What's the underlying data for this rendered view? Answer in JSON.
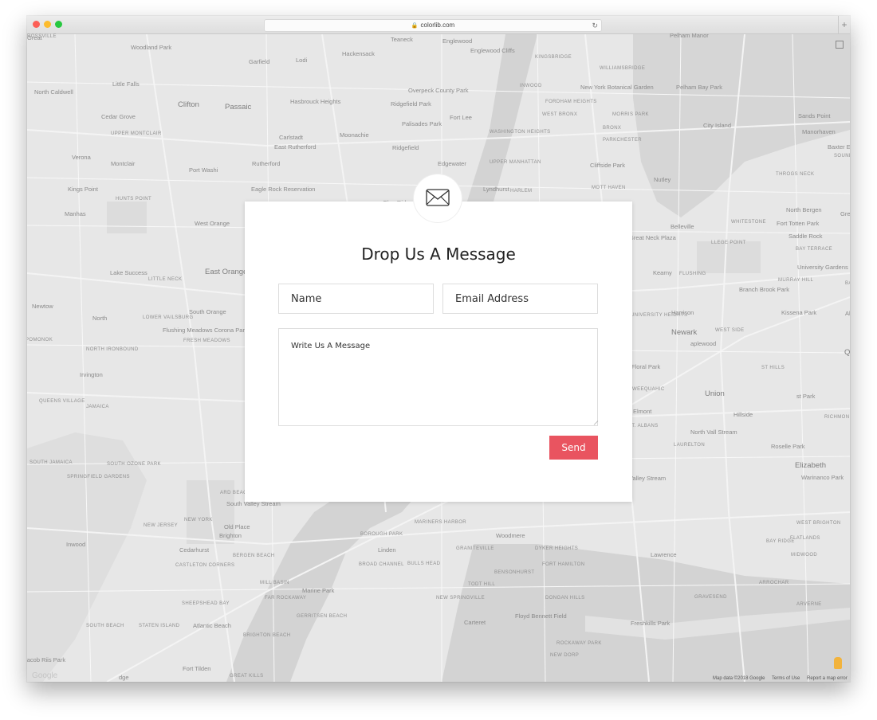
{
  "browser": {
    "url": "colorlib.com"
  },
  "map": {
    "labels": [
      {
        "text": "Woodland Park",
        "cls": ""
      },
      {
        "text": "Garfield",
        "cls": ""
      },
      {
        "text": "Lodi",
        "cls": ""
      },
      {
        "text": "Hackensack",
        "cls": ""
      },
      {
        "text": "Teaneck",
        "cls": ""
      },
      {
        "text": "Englewood",
        "cls": ""
      },
      {
        "text": "Englewood Cliffs",
        "cls": ""
      },
      {
        "text": "KINGSBRIDGE",
        "cls": "caps"
      },
      {
        "text": "WILLIAMSBRIDGE",
        "cls": "caps"
      },
      {
        "text": "Pelham Manor",
        "cls": ""
      },
      {
        "text": "Little Falls",
        "cls": ""
      },
      {
        "text": "North Caldwell",
        "cls": ""
      },
      {
        "text": "Clifton",
        "cls": "big"
      },
      {
        "text": "Passaic",
        "cls": "big"
      },
      {
        "text": "Hasbrouck Heights",
        "cls": ""
      },
      {
        "text": "Overpeck County Park",
        "cls": ""
      },
      {
        "text": "Ridgefield Park",
        "cls": ""
      },
      {
        "text": "INWOOD",
        "cls": "caps"
      },
      {
        "text": "New York Botanical Garden",
        "cls": ""
      },
      {
        "text": "Pelham Bay Park",
        "cls": ""
      },
      {
        "text": "Cedar Grove",
        "cls": ""
      },
      {
        "text": "UPPER MONTCLAIR",
        "cls": "caps"
      },
      {
        "text": "Palisades Park",
        "cls": ""
      },
      {
        "text": "Fort Lee",
        "cls": ""
      },
      {
        "text": "FORDHAM HEIGHTS",
        "cls": "caps"
      },
      {
        "text": "WEST BRONX",
        "cls": "caps"
      },
      {
        "text": "MORRIS PARK",
        "cls": "caps"
      },
      {
        "text": "City Island",
        "cls": ""
      },
      {
        "text": "Sands Point",
        "cls": ""
      },
      {
        "text": "Carlstadt",
        "cls": ""
      },
      {
        "text": "Moonachie",
        "cls": ""
      },
      {
        "text": "WASHINGTON HEIGHTS",
        "cls": "caps"
      },
      {
        "text": "BRONX",
        "cls": "caps"
      },
      {
        "text": "Manorhaven",
        "cls": ""
      },
      {
        "text": "East Rutherford",
        "cls": ""
      },
      {
        "text": "Ridgefield",
        "cls": ""
      },
      {
        "text": "PARKCHESTER",
        "cls": "caps"
      },
      {
        "text": "Baxter E",
        "cls": ""
      },
      {
        "text": "Verona",
        "cls": ""
      },
      {
        "text": "Montclair",
        "cls": ""
      },
      {
        "text": "Rutherford",
        "cls": ""
      },
      {
        "text": "Edgewater",
        "cls": ""
      },
      {
        "text": "UPPER MANHATTAN",
        "cls": "caps"
      },
      {
        "text": "Cliffside Park",
        "cls": ""
      },
      {
        "text": "SOUNDVIEW",
        "cls": "caps"
      },
      {
        "text": "Port Washi",
        "cls": ""
      },
      {
        "text": "Nutley",
        "cls": ""
      },
      {
        "text": "THROGS NECK",
        "cls": "caps"
      },
      {
        "text": "Kings Point",
        "cls": ""
      },
      {
        "text": "Eagle Rock Reservation",
        "cls": ""
      },
      {
        "text": "Lyndhurst",
        "cls": ""
      },
      {
        "text": "HARLEM",
        "cls": "caps"
      },
      {
        "text": "MOTT HAVEN",
        "cls": "caps"
      },
      {
        "text": "HUNTS POINT",
        "cls": "caps"
      },
      {
        "text": "Glen Ridge",
        "cls": ""
      },
      {
        "text": "North Bergen",
        "cls": ""
      },
      {
        "text": "Great Neck",
        "cls": ""
      },
      {
        "text": "Manhas",
        "cls": ""
      },
      {
        "text": "West Orange",
        "cls": ""
      },
      {
        "text": "Belleville",
        "cls": ""
      },
      {
        "text": "WHITESTONE",
        "cls": "caps"
      },
      {
        "text": "Fort Totten Park",
        "cls": ""
      },
      {
        "text": "Saddle Rock",
        "cls": ""
      },
      {
        "text": "Great Neck Plaza",
        "cls": ""
      },
      {
        "text": "LLEGE POINT",
        "cls": "caps"
      },
      {
        "text": "BAY TERRACE",
        "cls": "caps"
      },
      {
        "text": "University Gardens",
        "cls": ""
      },
      {
        "text": "Lake Success",
        "cls": ""
      },
      {
        "text": "East Orange",
        "cls": "big"
      },
      {
        "text": "Kearny",
        "cls": ""
      },
      {
        "text": "FLUSHING",
        "cls": "caps"
      },
      {
        "text": "MURRAY HILL",
        "cls": "caps"
      },
      {
        "text": "LITTLE NECK",
        "cls": "caps"
      },
      {
        "text": "Branch Brook Park",
        "cls": ""
      },
      {
        "text": "BAYSIDE",
        "cls": "caps"
      },
      {
        "text": "Newtow",
        "cls": ""
      },
      {
        "text": "South Orange",
        "cls": ""
      },
      {
        "text": "Harrison",
        "cls": ""
      },
      {
        "text": "Kissena Park",
        "cls": ""
      },
      {
        "text": "Alley Pond Park",
        "cls": ""
      },
      {
        "text": "North",
        "cls": ""
      },
      {
        "text": "LOWER VAILSBURG",
        "cls": "caps"
      },
      {
        "text": "UNIVERSITY HEIGHTS",
        "cls": "caps"
      },
      {
        "text": "Flushing Meadows Corona Park",
        "cls": ""
      },
      {
        "text": "Newark",
        "cls": "big"
      },
      {
        "text": "WEST SIDE",
        "cls": "caps"
      },
      {
        "text": "POMONOK",
        "cls": "caps"
      },
      {
        "text": "FRESH MEADOWS",
        "cls": "caps"
      },
      {
        "text": "aplewood",
        "cls": ""
      },
      {
        "text": "NORTH IRONBOUND",
        "cls": "caps"
      },
      {
        "text": "QUEENS",
        "cls": "big"
      },
      {
        "text": "Irvington",
        "cls": ""
      },
      {
        "text": "Floral Park",
        "cls": ""
      },
      {
        "text": "ST HILLS",
        "cls": "caps"
      },
      {
        "text": "QUEENS VILLAGE",
        "cls": "caps"
      },
      {
        "text": "WEEQUAHIC",
        "cls": "caps"
      },
      {
        "text": "Union",
        "cls": "big"
      },
      {
        "text": "st Park",
        "cls": ""
      },
      {
        "text": "JAMAICA",
        "cls": "caps"
      },
      {
        "text": "Elmont",
        "cls": ""
      },
      {
        "text": "Hillside",
        "cls": ""
      },
      {
        "text": "RICHMOND HILL",
        "cls": "caps"
      },
      {
        "text": "ST. ALBANS",
        "cls": "caps"
      },
      {
        "text": "North Vall Stream",
        "cls": ""
      },
      {
        "text": "SOUTH JAMAICA",
        "cls": "caps"
      },
      {
        "text": "SOUTH OZONE PARK",
        "cls": "caps"
      },
      {
        "text": "LAURELTON",
        "cls": "caps"
      },
      {
        "text": "Roselle Park",
        "cls": ""
      },
      {
        "text": "Elizabeth",
        "cls": "big"
      },
      {
        "text": "SPRINGFIELD GARDENS",
        "cls": "caps"
      },
      {
        "text": "Valley Stream",
        "cls": ""
      },
      {
        "text": "Warinanco Park",
        "cls": ""
      },
      {
        "text": "ARD BEACH",
        "cls": "caps"
      },
      {
        "text": "South Valley Stream",
        "cls": ""
      },
      {
        "text": "NEW JERSEY",
        "cls": "caps"
      },
      {
        "text": "NEW YORK",
        "cls": "caps"
      },
      {
        "text": "Old Place",
        "cls": ""
      },
      {
        "text": "MARINERS HARBOR",
        "cls": "caps"
      },
      {
        "text": "Brighton",
        "cls": ""
      },
      {
        "text": "BOROUGH PARK",
        "cls": "caps"
      },
      {
        "text": "Woodmere",
        "cls": ""
      },
      {
        "text": "WEST BRIGHTON",
        "cls": "caps"
      },
      {
        "text": "BAY RIDGE",
        "cls": "caps"
      },
      {
        "text": "FLATLANDS",
        "cls": "caps"
      },
      {
        "text": "Inwood",
        "cls": ""
      },
      {
        "text": "Cedarhurst",
        "cls": ""
      },
      {
        "text": "Linden",
        "cls": ""
      },
      {
        "text": "GRANITEVILLE",
        "cls": "caps"
      },
      {
        "text": "DYKER HEIGHTS",
        "cls": "caps"
      },
      {
        "text": "MIDWOOD",
        "cls": "caps"
      },
      {
        "text": "BERGEN BEACH",
        "cls": "caps"
      },
      {
        "text": "Lawrence",
        "cls": ""
      },
      {
        "text": "CASTLETON CORNERS",
        "cls": "caps"
      },
      {
        "text": "BROAD CHANNEL",
        "cls": "caps"
      },
      {
        "text": "BULLS HEAD",
        "cls": "caps"
      },
      {
        "text": "FORT HAMILTON",
        "cls": "caps"
      },
      {
        "text": "BENSONHURST",
        "cls": "caps"
      },
      {
        "text": "MILL BASIN",
        "cls": "caps"
      },
      {
        "text": "Marine Park",
        "cls": ""
      },
      {
        "text": "TODT HILL",
        "cls": "caps"
      },
      {
        "text": "ARROCHAR",
        "cls": "caps"
      },
      {
        "text": "SHEEPSHEAD BAY",
        "cls": "caps"
      },
      {
        "text": "FAR ROCKAWAY",
        "cls": "caps"
      },
      {
        "text": "NEW SPRINGVILLE",
        "cls": "caps"
      },
      {
        "text": "DONGAN HILLS",
        "cls": "caps"
      },
      {
        "text": "GRAVESEND",
        "cls": "caps"
      },
      {
        "text": "Floyd Bennett Field",
        "cls": ""
      },
      {
        "text": "ARVERNE",
        "cls": "caps"
      },
      {
        "text": "GERRITSEN BEACH",
        "cls": "caps"
      },
      {
        "text": "Atlantic Beach",
        "cls": ""
      },
      {
        "text": "SOUTH BEACH",
        "cls": "caps"
      },
      {
        "text": "STATEN ISLAND",
        "cls": "caps"
      },
      {
        "text": "Carteret",
        "cls": ""
      },
      {
        "text": "Freshkills Park",
        "cls": ""
      },
      {
        "text": "BRIGHTON BEACH",
        "cls": "caps"
      },
      {
        "text": "ROCKAWAY PARK",
        "cls": "caps"
      },
      {
        "text": "NEW DORP",
        "cls": "caps"
      },
      {
        "text": "Jacob Riis Park",
        "cls": ""
      },
      {
        "text": "Fort Tilden",
        "cls": ""
      },
      {
        "text": "dge",
        "cls": ""
      },
      {
        "text": "GREAT KILLS",
        "cls": "caps"
      },
      {
        "text": "ROSSVILLE",
        "cls": "caps"
      },
      {
        "text": "Great",
        "cls": ""
      }
    ],
    "footer": {
      "map_data": "Map data ©2018 Google",
      "terms": "Terms of Use",
      "report": "Report a map error",
      "logo": "Google"
    }
  },
  "form": {
    "title": "Drop Us A Message",
    "name_placeholder": "Name",
    "email_placeholder": "Email Address",
    "message_placeholder": "Write Us A Message",
    "send_label": "Send"
  },
  "colors": {
    "accent": "#e95460",
    "map_background": "#e7e7e7"
  }
}
